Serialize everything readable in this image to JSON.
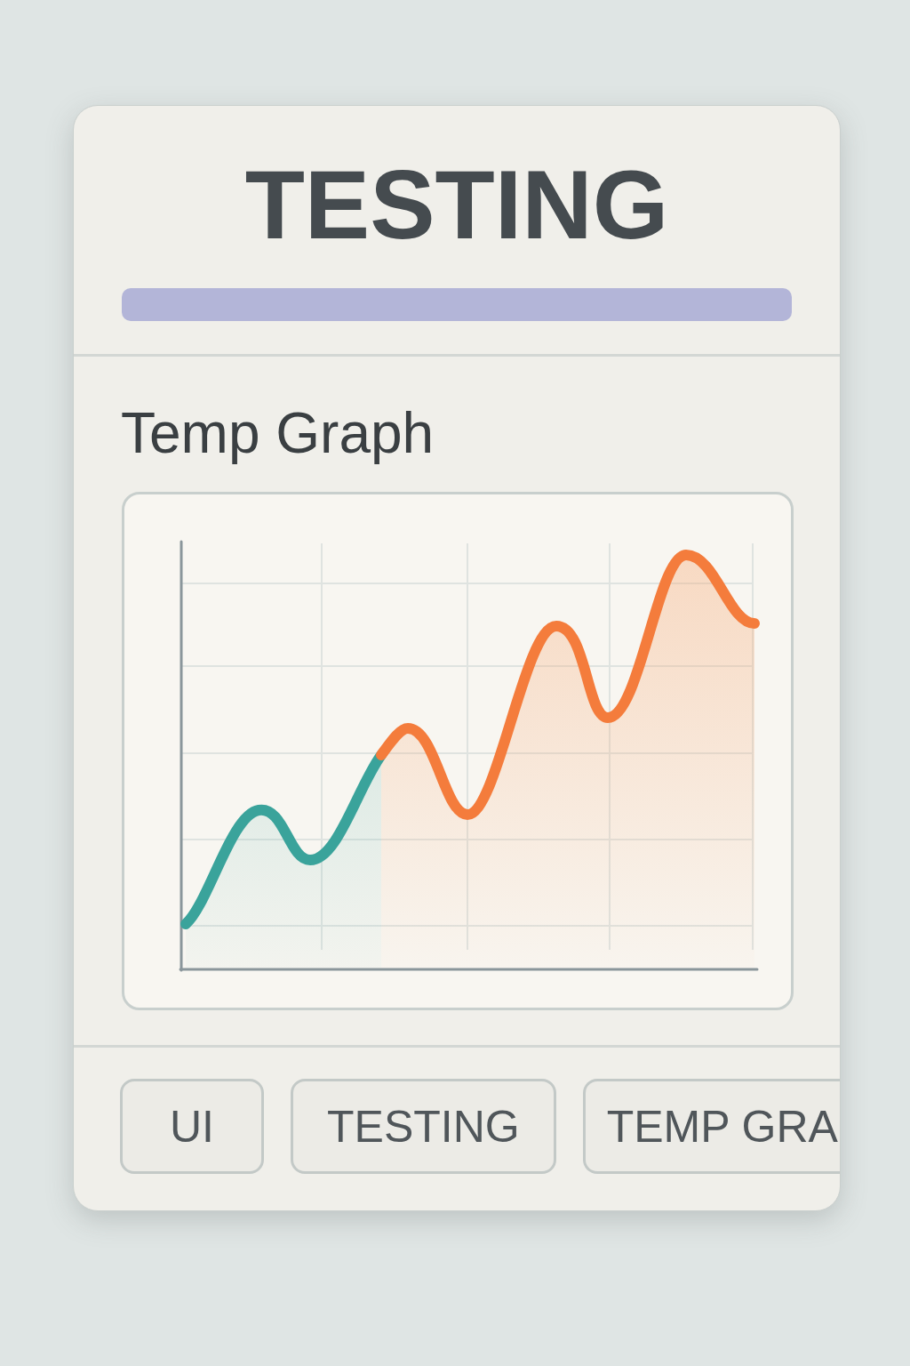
{
  "header": {
    "title": "TESTING"
  },
  "graph_panel": {
    "title": "Temp Graph"
  },
  "tags": [
    {
      "label": "UI",
      "cut_off": false
    },
    {
      "label": "TESTING",
      "cut_off": false
    },
    {
      "label": "TEMP GRA",
      "cut_off": true
    }
  ]
}
